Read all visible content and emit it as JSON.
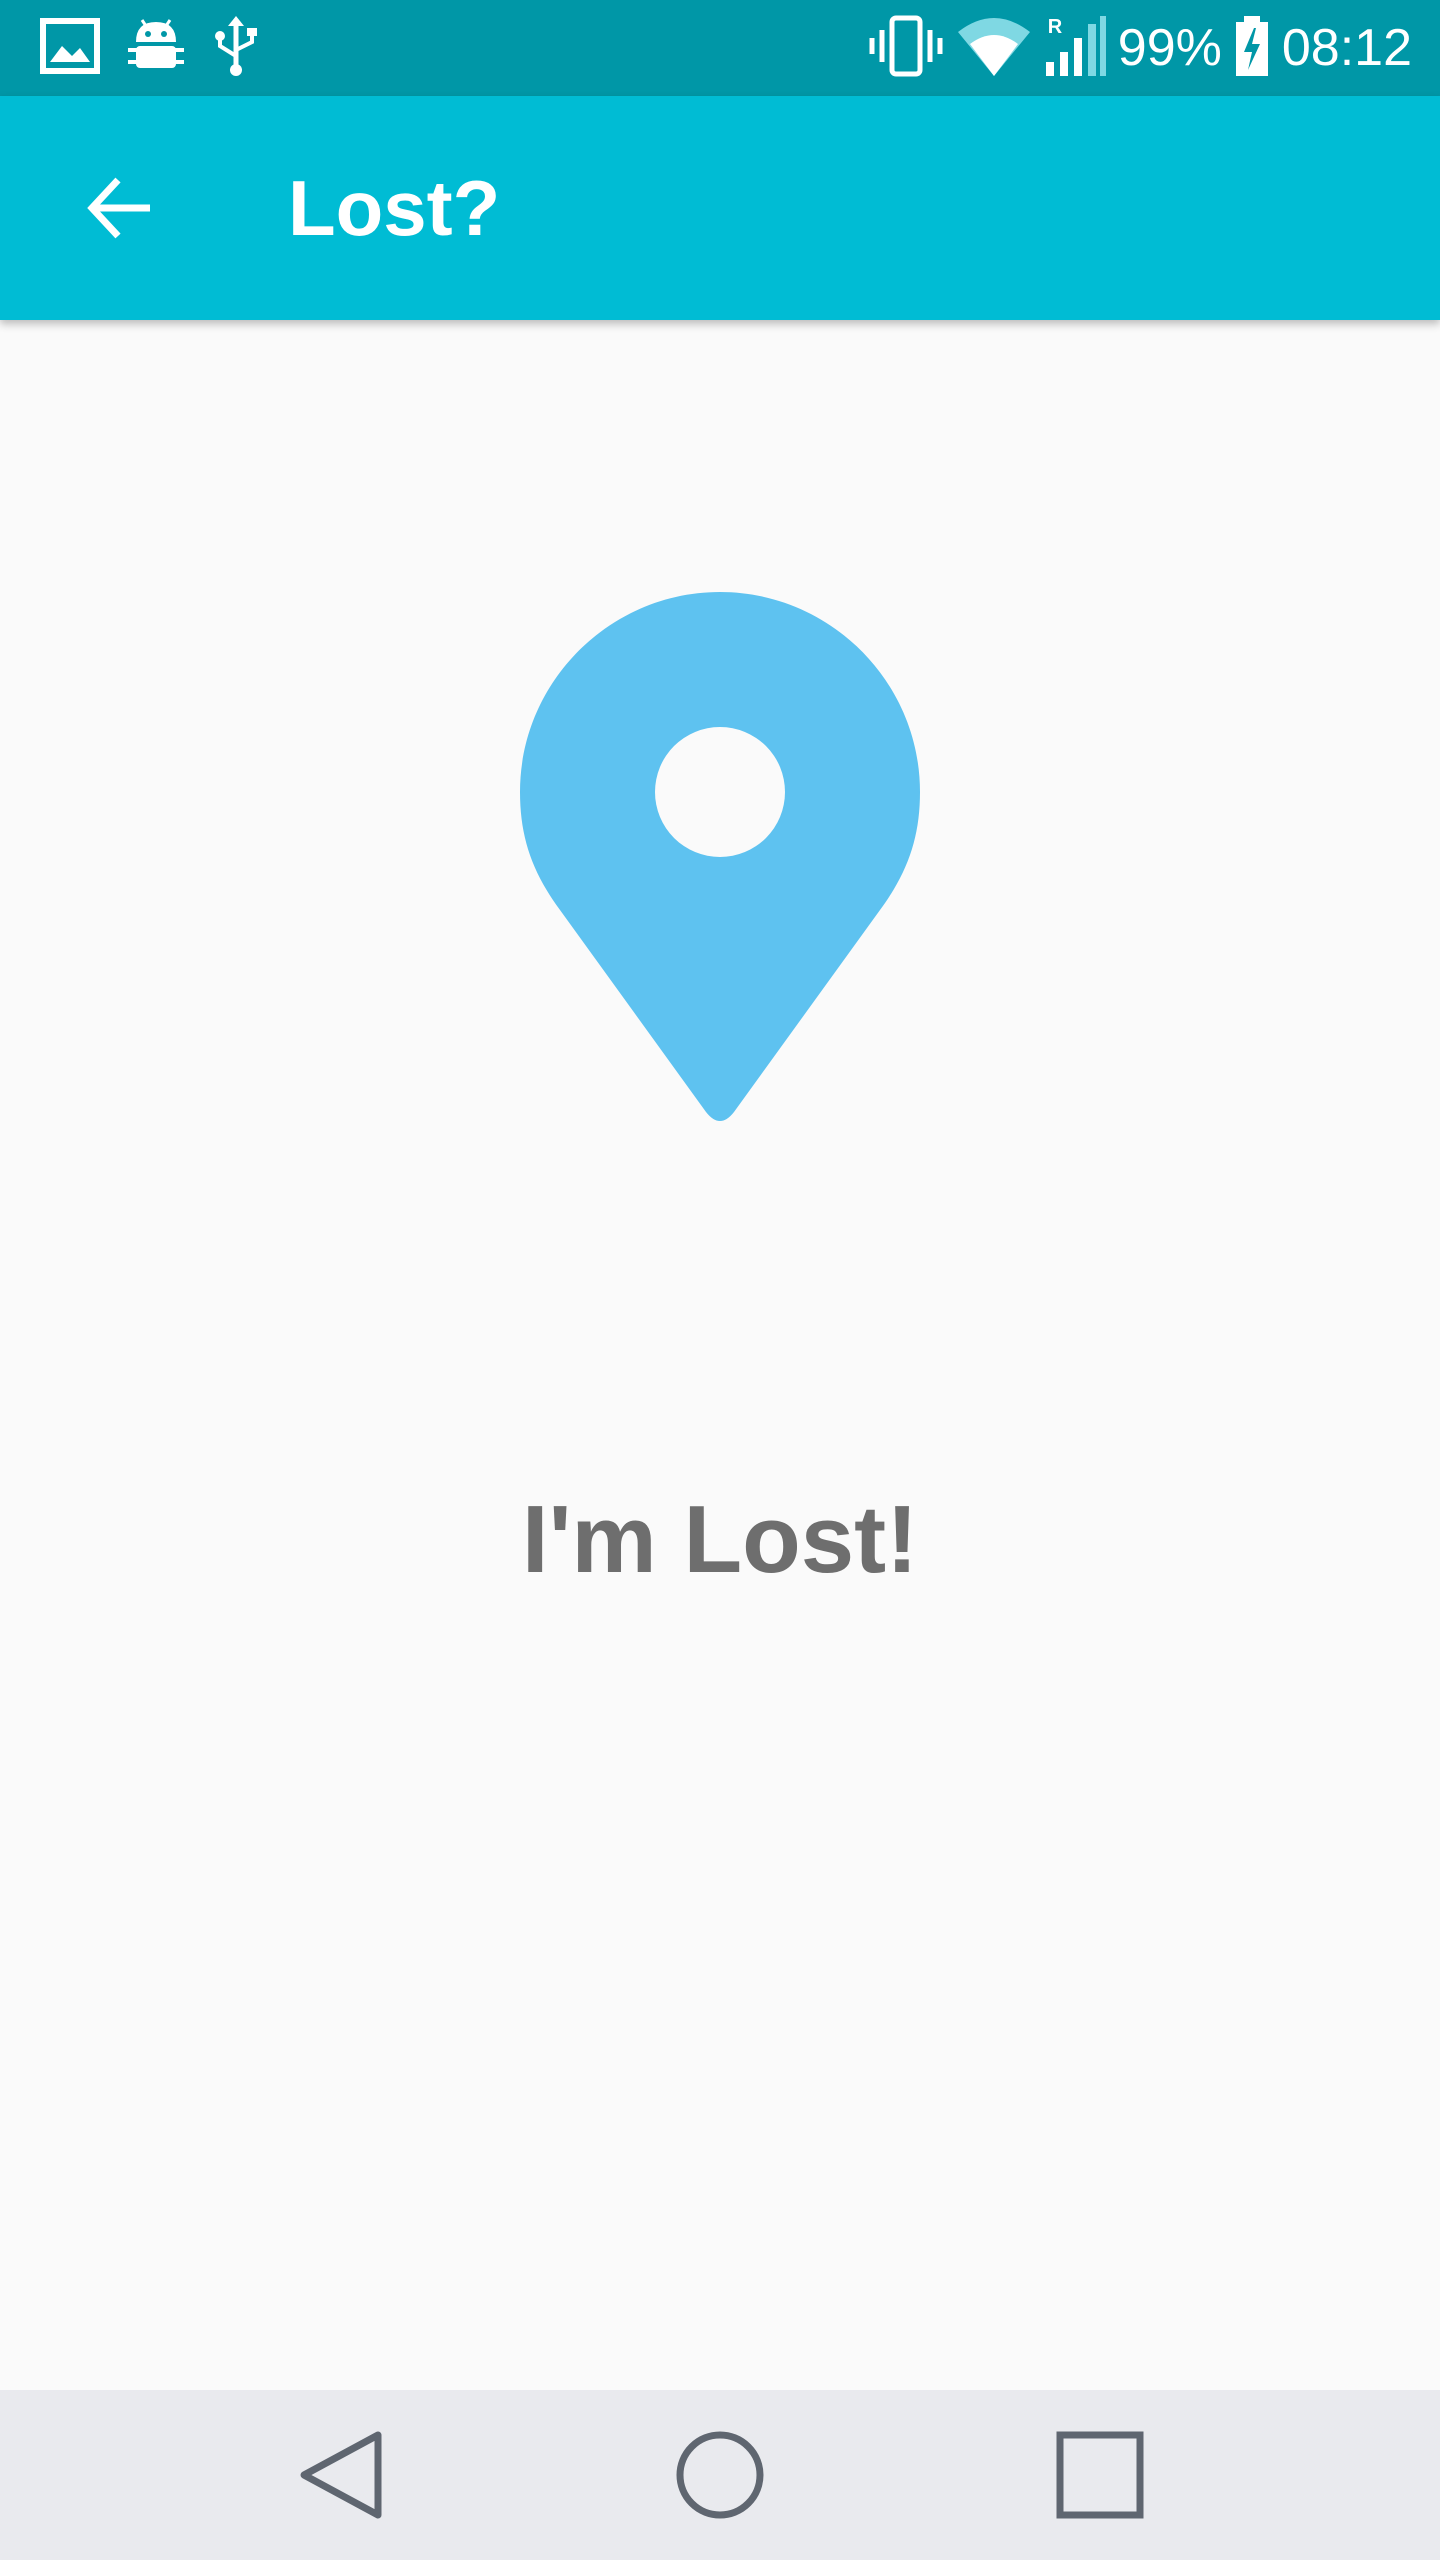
{
  "status_bar": {
    "left_icons": [
      "image-icon",
      "android-icon",
      "usb-icon"
    ],
    "right_icons": [
      "vibrate-icon",
      "wifi-icon",
      "signal-icon",
      "battery-icon"
    ],
    "signal_roaming": "R",
    "battery_percent": "99%",
    "clock": "08:12"
  },
  "app_bar": {
    "title": "Lost?",
    "back_icon": "arrow-back-icon"
  },
  "main": {
    "illustration_icon": "location-pin-icon",
    "message": "I'm Lost!"
  },
  "nav_bar": {
    "buttons": [
      "back-triangle-icon",
      "home-circle-icon",
      "recents-square-icon"
    ]
  },
  "colors": {
    "status_bar": "#0097a7",
    "app_bar": "#00bcd4",
    "pin": "#5ec2f0",
    "message_text": "#6e6e6e",
    "background": "#fafafa",
    "nav_bar": "#e9eaee",
    "nav_icons": "#5f6670"
  }
}
